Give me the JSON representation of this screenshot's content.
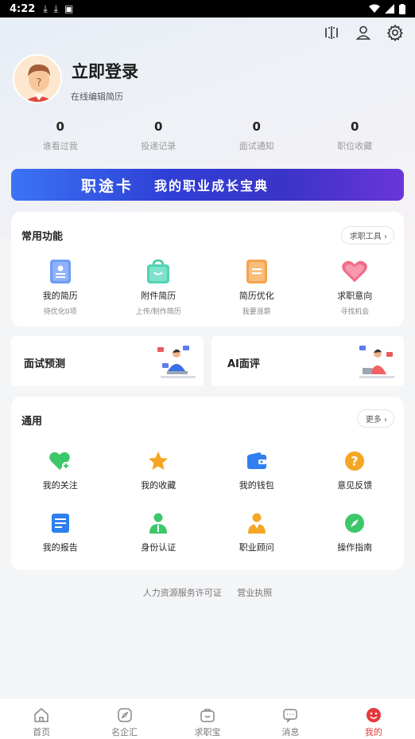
{
  "status_bar": {
    "time": "4:22",
    "icons": [
      "download-icon",
      "download-icon",
      "a-icon"
    ],
    "right_icons": [
      "wifi-icon",
      "signal-icon",
      "battery-icon"
    ]
  },
  "header": {
    "icons": [
      "scan-icon",
      "user-icon",
      "gear-icon"
    ]
  },
  "profile": {
    "title": "立即登录",
    "subtitle": "在线编辑简历"
  },
  "stats": [
    {
      "value": "0",
      "label": "谁看过我"
    },
    {
      "value": "0",
      "label": "投递记录"
    },
    {
      "value": "0",
      "label": "面试通知"
    },
    {
      "value": "0",
      "label": "职位收藏"
    }
  ],
  "banner": {
    "title": "职途卡",
    "subtitle": "我的职业成长宝典"
  },
  "common": {
    "title": "常用功能",
    "tool_button": "求职工具",
    "items": [
      {
        "title": "我的简历",
        "sub": "待优化0项",
        "icon": "resume-icon"
      },
      {
        "title": "附件简历",
        "sub": "上传/制作简历",
        "icon": "bag-icon"
      },
      {
        "title": "简历优化",
        "sub": "我要涨薪",
        "icon": "document-icon"
      },
      {
        "title": "求职意向",
        "sub": "寻找机会",
        "icon": "heart-icon"
      }
    ]
  },
  "mini_cards": [
    {
      "title": "面试预测"
    },
    {
      "title": "AI面评"
    }
  ],
  "general": {
    "title": "通用",
    "more_button": "更多",
    "row1": [
      {
        "title": "我的关注",
        "icon": "heart-plus-icon"
      },
      {
        "title": "我的收藏",
        "icon": "star-icon"
      },
      {
        "title": "我的钱包",
        "icon": "wallet-icon"
      },
      {
        "title": "意见反馈",
        "icon": "question-icon"
      }
    ],
    "row2": [
      {
        "title": "我的报告",
        "icon": "report-icon"
      },
      {
        "title": "身份认证",
        "icon": "id-person-icon"
      },
      {
        "title": "职业顾问",
        "icon": "advisor-icon"
      },
      {
        "title": "操作指南",
        "icon": "compass-icon"
      }
    ]
  },
  "footer_links": [
    "人力资源服务许可证",
    "营业执照"
  ],
  "tabbar": [
    {
      "label": "首页",
      "icon": "home-icon"
    },
    {
      "label": "名企汇",
      "icon": "compass-tab-icon"
    },
    {
      "label": "求职宝",
      "icon": "briefcase-icon"
    },
    {
      "label": "消息",
      "icon": "message-icon"
    },
    {
      "label": "我的",
      "icon": "me-icon",
      "active": true
    }
  ],
  "colors": {
    "accent": "#e43a3d",
    "banner": "#2f3fd6",
    "green": "#3cc76b",
    "orange": "#f5a623",
    "blue": "#2f7ff0"
  }
}
